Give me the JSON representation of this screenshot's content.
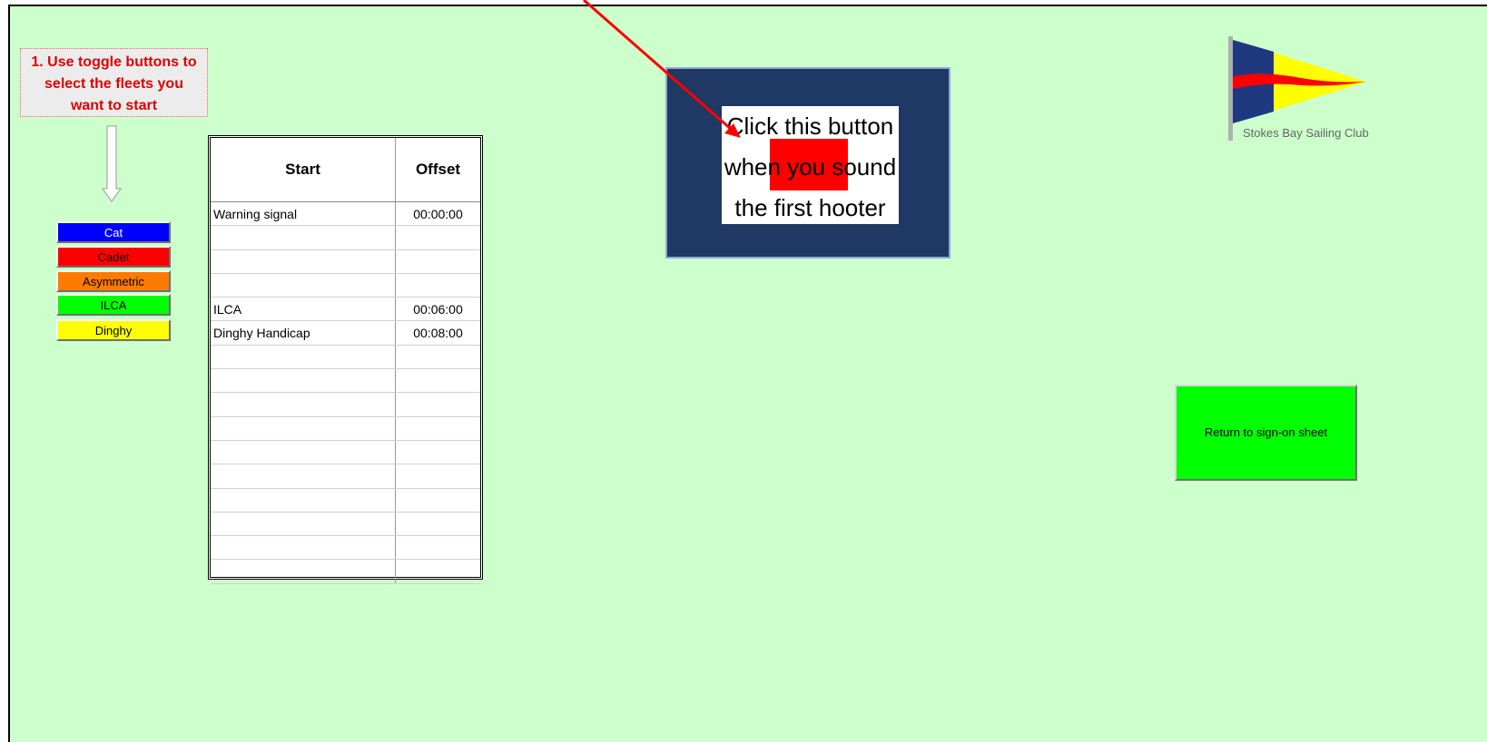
{
  "instruction": {
    "line1": "1.  Use toggle buttons to",
    "line2": "select the fleets you",
    "line3": "want to start"
  },
  "fleet_buttons": [
    {
      "label": "Cat",
      "bg": "#0000ff",
      "fg": "#ffffff"
    },
    {
      "label": "Cadet",
      "bg": "#ff0000",
      "fg": "#000000"
    },
    {
      "label": "Asymmetric",
      "bg": "#ff7a00",
      "fg": "#000000"
    },
    {
      "label": "ILCA",
      "bg": "#00ff00",
      "fg": "#000000"
    },
    {
      "label": "Dinghy",
      "bg": "#ffff00",
      "fg": "#000000"
    }
  ],
  "schedule": {
    "col_start": "Start",
    "col_offset": "Offset",
    "rows": [
      {
        "start": "Warning signal",
        "offset": "00:00:00"
      },
      {
        "start": "",
        "offset": ""
      },
      {
        "start": "",
        "offset": ""
      },
      {
        "start": "",
        "offset": ""
      },
      {
        "start": "ILCA",
        "offset": "00:06:00"
      },
      {
        "start": "Dinghy Handicap",
        "offset": "00:08:00"
      },
      {
        "start": "",
        "offset": ""
      },
      {
        "start": "",
        "offset": ""
      },
      {
        "start": "",
        "offset": ""
      },
      {
        "start": "",
        "offset": ""
      },
      {
        "start": "",
        "offset": ""
      },
      {
        "start": "",
        "offset": ""
      },
      {
        "start": "",
        "offset": ""
      },
      {
        "start": "",
        "offset": ""
      },
      {
        "start": "",
        "offset": ""
      },
      {
        "start": "",
        "offset": ""
      }
    ]
  },
  "hooter_button": {
    "line1": "Click this button",
    "line2": "when you sound",
    "line3": "the first hooter"
  },
  "logo": {
    "text": "Stokes Bay Sailing Club"
  },
  "return_button": {
    "label": "Return to sign-on sheet"
  },
  "colors": {
    "sheet_bg": "#ccffcc",
    "accent_red": "#e00000",
    "hooter_bg": "#203864",
    "return_bg": "#00ff00"
  }
}
